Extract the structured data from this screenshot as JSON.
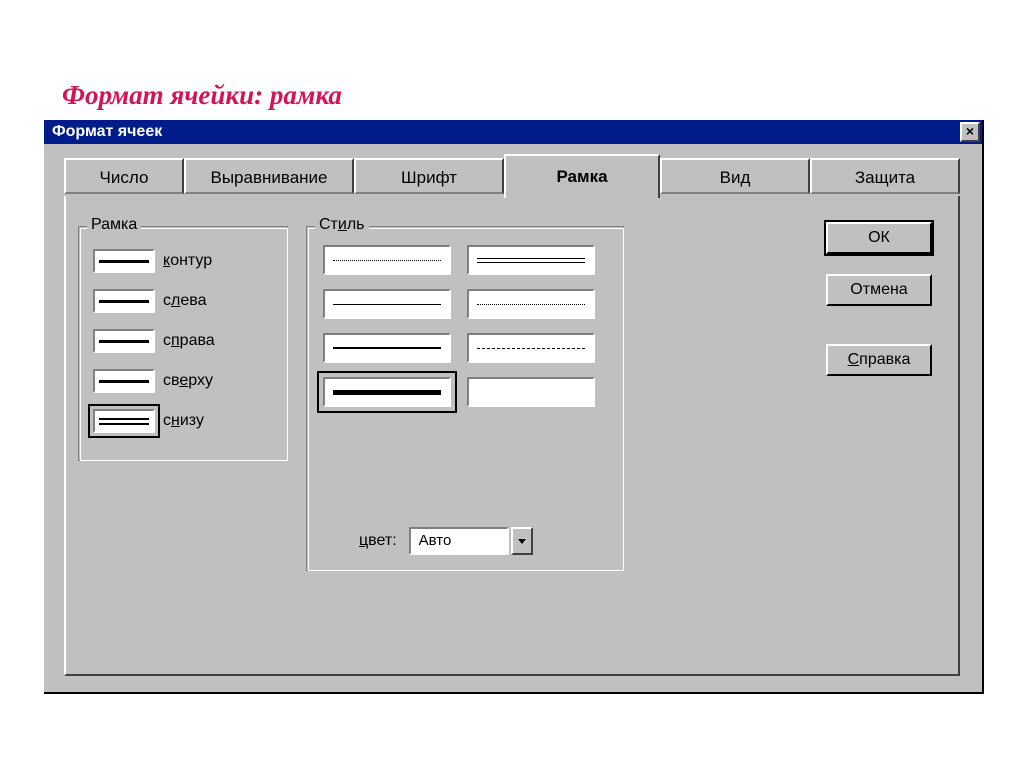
{
  "caption": "Формат ячейки:  рамка",
  "dialog": {
    "title": "Формат ячеек",
    "tabs": [
      {
        "label": "Число"
      },
      {
        "label": "Выравнивание"
      },
      {
        "label": "Шрифт"
      },
      {
        "label": "Рамка",
        "active": true
      },
      {
        "label": "Вид"
      },
      {
        "label": "Защита"
      }
    ],
    "groups": {
      "frame": {
        "title": "Рамка",
        "items": [
          {
            "label_pre": "",
            "label_u": "к",
            "label_post": "онтур",
            "style": "thick",
            "selected": false
          },
          {
            "label_pre": "с",
            "label_u": "л",
            "label_post": "ева",
            "style": "thick",
            "selected": false
          },
          {
            "label_pre": "с",
            "label_u": "п",
            "label_post": "рава",
            "style": "thick",
            "selected": false
          },
          {
            "label_pre": "св",
            "label_u": "е",
            "label_post": "рху",
            "style": "thick",
            "selected": false
          },
          {
            "label_pre": "с",
            "label_u": "н",
            "label_post": "изу",
            "style": "double",
            "selected": true
          }
        ]
      },
      "style": {
        "title_pre": "Ст",
        "title_u": "и",
        "title_post": "ль",
        "cells": [
          {
            "kind": "dotted-fine",
            "selected": false
          },
          {
            "kind": "double-thin",
            "selected": false
          },
          {
            "kind": "solid-thin",
            "selected": false
          },
          {
            "kind": "dotted-med",
            "selected": false
          },
          {
            "kind": "solid-med",
            "selected": false
          },
          {
            "kind": "dashed",
            "selected": false
          },
          {
            "kind": "thickbar",
            "selected": true
          },
          {
            "kind": "blank",
            "selected": false
          }
        ],
        "color_label_u": "ц",
        "color_label_rest": "вет:",
        "color_value": "Авто"
      }
    },
    "buttons": {
      "ok": "ОК",
      "cancel": "Отмена",
      "help_u": "С",
      "help_rest": "правка"
    }
  }
}
